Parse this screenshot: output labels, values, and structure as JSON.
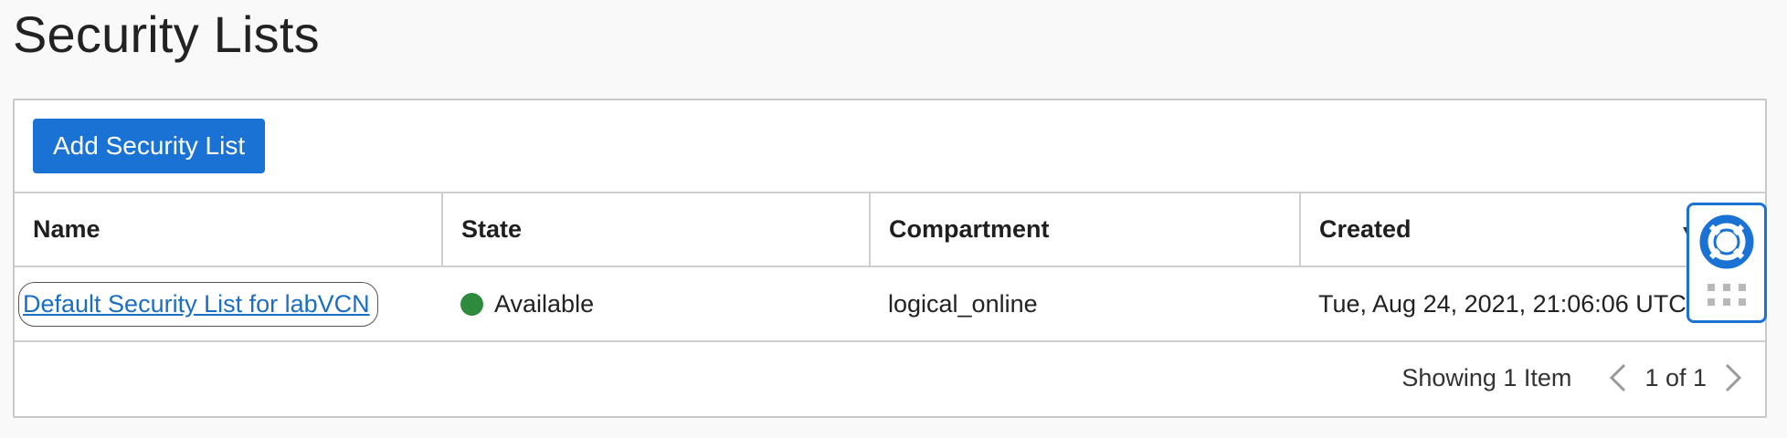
{
  "page": {
    "title": "Security Lists"
  },
  "toolbar": {
    "add_label": "Add Security List"
  },
  "table": {
    "columns": [
      "Name",
      "State",
      "Compartment",
      "Created"
    ],
    "rows": [
      {
        "name": "Default Security List for labVCN",
        "state": "Available",
        "compartment": "logical_online",
        "created": "Tue, Aug 24, 2021, 21:06:06 UTC"
      }
    ]
  },
  "pager": {
    "showing": "Showing 1 Item",
    "page_of": "1 of 1"
  },
  "colors": {
    "accent": "#1a73d4",
    "link": "#1a6fc2",
    "status_available": "#2e8b3e"
  },
  "icons": {
    "help": "lifebuoy-icon",
    "grip": "grip-dots-icon",
    "prev": "chevron-left-icon",
    "next": "chevron-right-icon",
    "sort": "sort-caret-icon"
  }
}
